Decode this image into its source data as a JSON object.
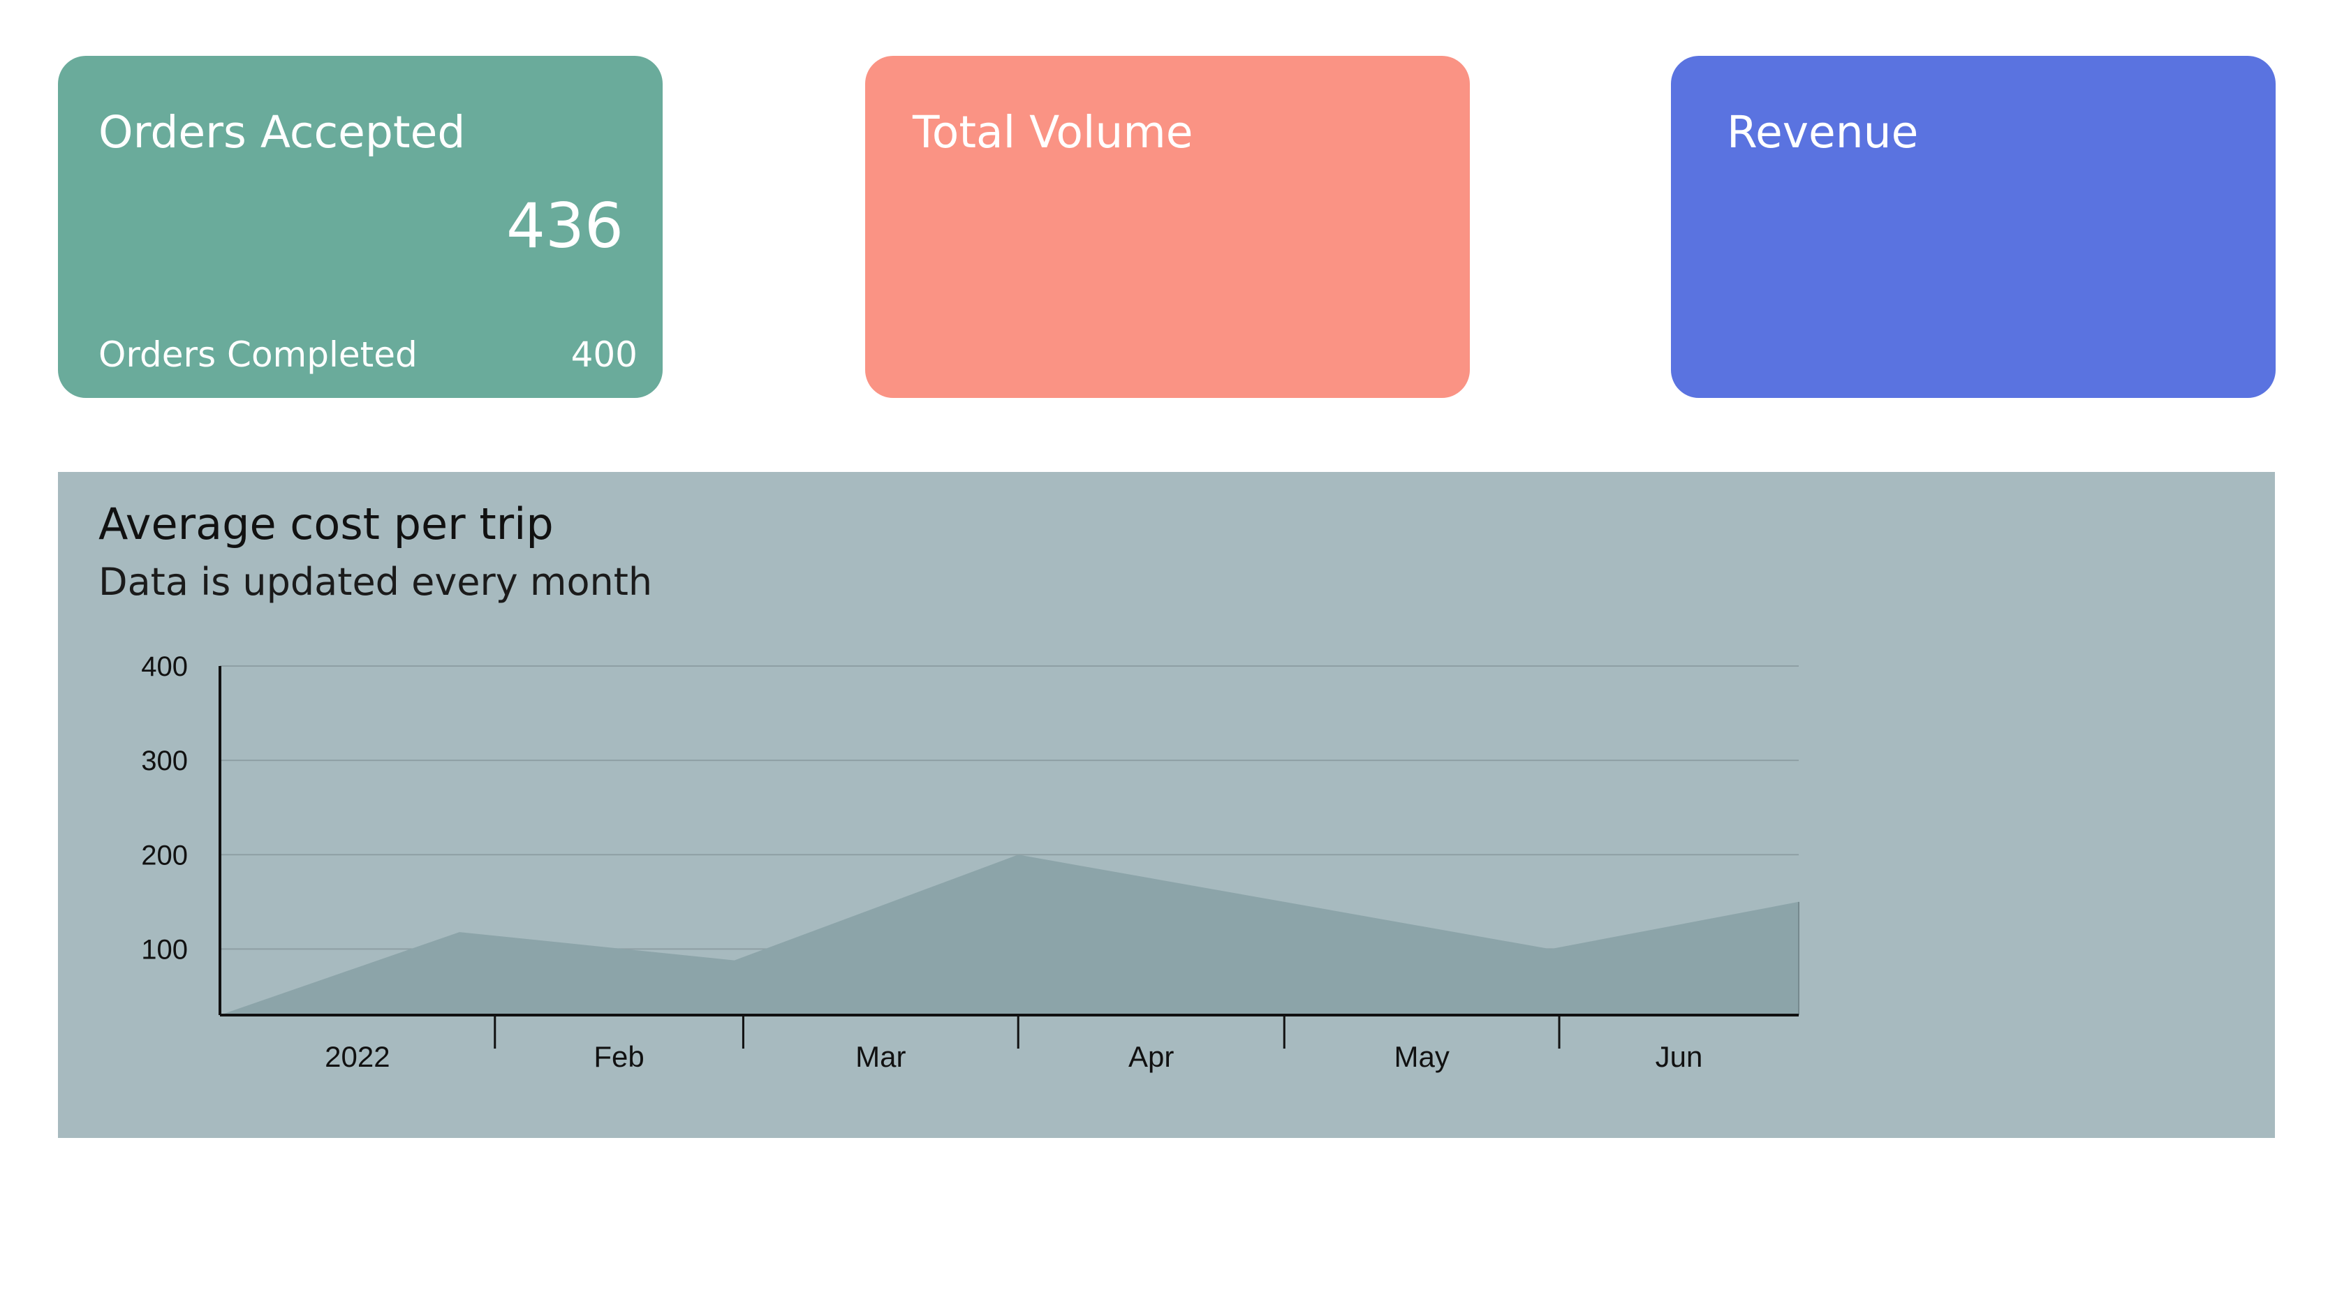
{
  "cards": {
    "orders": {
      "title": "Orders Accepted",
      "value": "436",
      "footer_label": "Orders Completed",
      "footer_value": "400",
      "color": "#6aab9b"
    },
    "volume": {
      "title": "Total Volume",
      "color": "#fa9384"
    },
    "revenue": {
      "title": "Revenue",
      "color": "#5a73e0"
    }
  },
  "chart_panel": {
    "title": "Average cost per trip",
    "subtitle": "Data is updated every month",
    "background": "#a7babf"
  },
  "chart_data": {
    "type": "area",
    "title": "Average cost per trip",
    "subtitle": "Data is updated every month",
    "xlabel": "",
    "ylabel": "",
    "x_tick_labels": [
      "2022",
      "Feb",
      "Mar",
      "Apr",
      "May",
      "Jun"
    ],
    "y_ticks": [
      100,
      200,
      300,
      400
    ],
    "ylim": [
      30,
      400
    ],
    "grid": true,
    "legend": "none",
    "series": [
      {
        "x": [
          "2022-01-01",
          "2022-01-28",
          "2022-02-28",
          "2022-04-01",
          "2022-05-31",
          "2022-06-28"
        ],
        "values": [
          30,
          118,
          88,
          200,
          100,
          150
        ],
        "fill": "#8ca4a9"
      }
    ]
  }
}
